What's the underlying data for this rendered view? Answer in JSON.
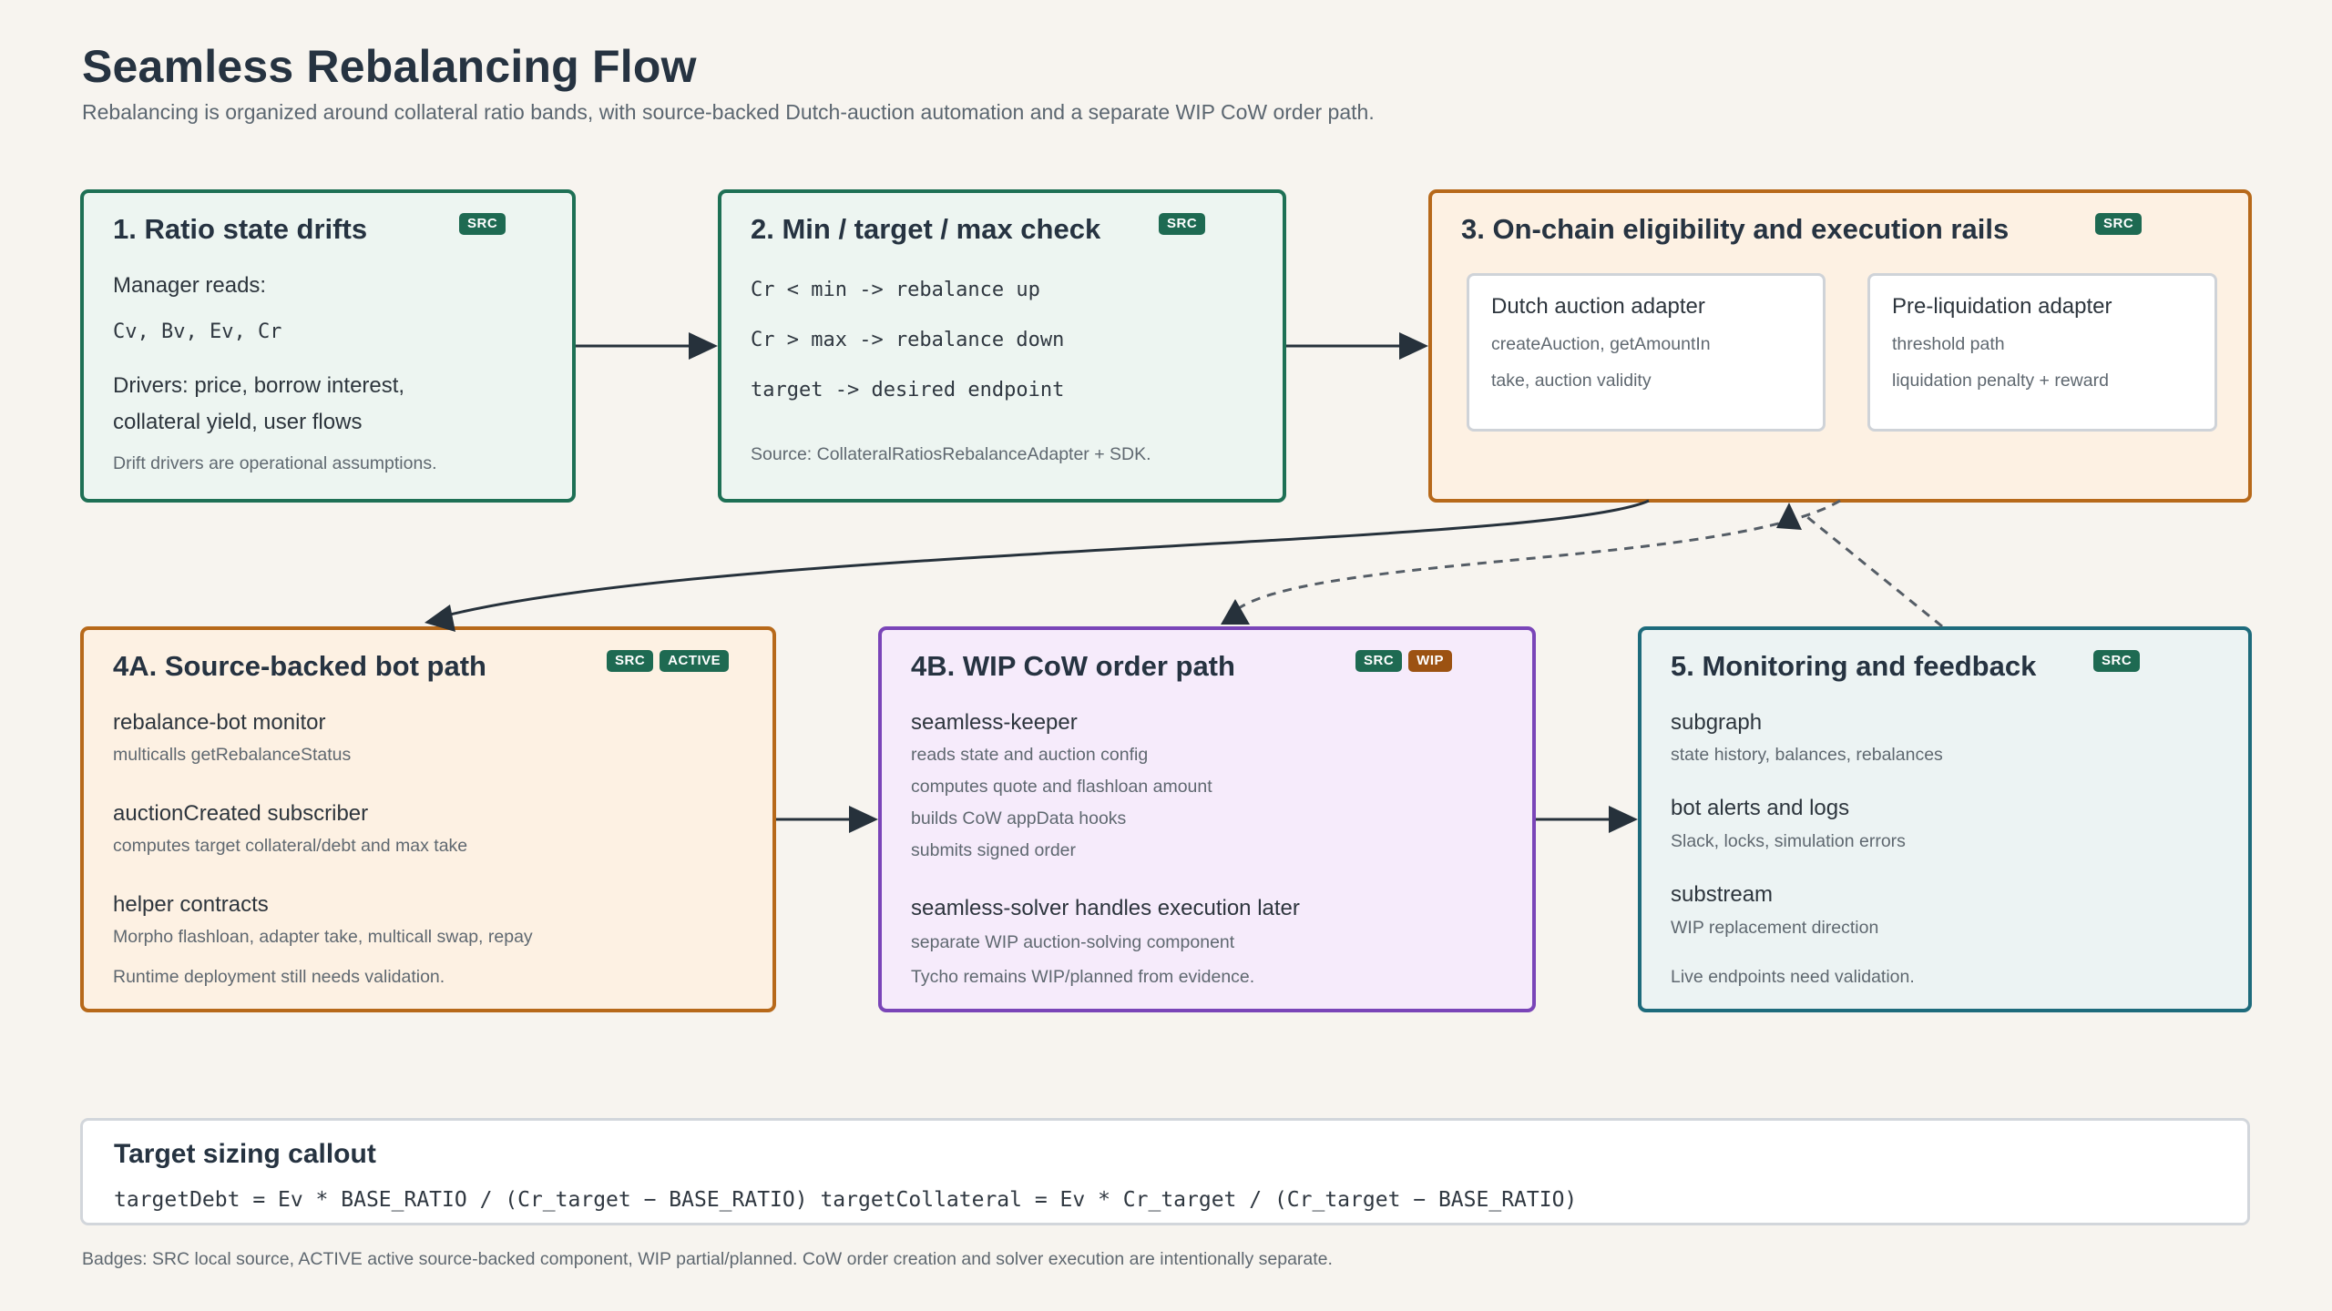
{
  "header": {
    "title": "Seamless Rebalancing Flow",
    "subtitle": "Rebalancing is organized around collateral ratio bands, with source-backed Dutch-auction automation and a separate WIP CoW order path."
  },
  "badges": {
    "src": "SRC",
    "active": "ACTIVE",
    "wip": "WIP"
  },
  "step1": {
    "title": "1. Ratio state drifts",
    "manager_reads_label": "Manager reads:",
    "manager_reads_values": "Cv, Bv, Ev, Cr",
    "drivers_line1": "Drivers: price, borrow interest,",
    "drivers_line2": "collateral yield, user flows",
    "note": "Drift drivers are operational assumptions."
  },
  "step2": {
    "title": "2. Min / target / max check",
    "rule1": "Cr < min -> rebalance up",
    "rule2": "Cr > max -> rebalance down",
    "rule3": "target -> desired endpoint",
    "source": "Source: CollateralRatiosRebalanceAdapter + SDK."
  },
  "step3": {
    "title": "3. On-chain eligibility and execution rails",
    "dutch": {
      "title": "Dutch auction adapter",
      "line1": "createAuction, getAmountIn",
      "line2": "take, auction validity"
    },
    "preliq": {
      "title": "Pre-liquidation adapter",
      "line1": "threshold path",
      "line2": "liquidation penalty + reward"
    }
  },
  "step4a": {
    "title": "4A. Source-backed bot path",
    "items": [
      {
        "title": "rebalance-bot monitor",
        "desc": "multicalls getRebalanceStatus"
      },
      {
        "title": "auctionCreated subscriber",
        "desc": "computes target collateral/debt and max take"
      },
      {
        "title": "helper contracts",
        "desc": "Morpho flashloan, adapter take, multicall swap, repay"
      }
    ],
    "note": "Runtime deployment still needs validation."
  },
  "step4b": {
    "title": "4B. WIP CoW order path",
    "keeper_title": "seamless-keeper",
    "keeper_lines": [
      "reads state and auction config",
      "computes quote and flashloan amount",
      "builds CoW appData hooks",
      "submits signed order"
    ],
    "solver_title": "seamless-solver handles execution later",
    "solver_desc": "separate WIP auction-solving component",
    "note": "Tycho remains WIP/planned from evidence."
  },
  "step5": {
    "title": "5. Monitoring and feedback",
    "items": [
      {
        "title": "subgraph",
        "desc": "state history, balances, rebalances"
      },
      {
        "title": "bot alerts and logs",
        "desc": "Slack, locks, simulation errors"
      },
      {
        "title": "substream",
        "desc": "WIP replacement direction"
      }
    ],
    "note": "Live endpoints need validation."
  },
  "callout": {
    "title": "Target sizing callout",
    "formula": "targetDebt = Ev * BASE_RATIO / (Cr_target − BASE_RATIO) targetCollateral = Ev * Cr_target / (Cr_target − BASE_RATIO)"
  },
  "footnote": "Badges: SRC local source, ACTIVE active source-backed component, WIP partial/planned. CoW order creation and solver execution are intentionally separate.",
  "colors": {
    "background": "#f7f4ef",
    "green_border": "#1e7055",
    "orange_border": "#b7691a",
    "purple_border": "#7a45b8",
    "teal_border": "#1e6b7c",
    "arrow": "#26313b"
  }
}
